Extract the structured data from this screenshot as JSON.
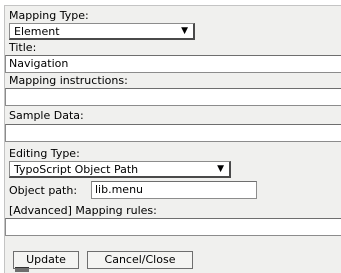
{
  "form": {
    "mapping_type_label": "Mapping Type:",
    "mapping_type_value": "Element",
    "title_label": "Title:",
    "title_value": "Navigation",
    "instructions_label": "Mapping instructions:",
    "instructions_value": "",
    "sample_label": "Sample Data:",
    "sample_value": "",
    "editing_type_label": "Editing Type:",
    "editing_type_value": "TypoScript Object Path",
    "object_path_label": "Object path:",
    "object_path_value": "lib.menu",
    "mapping_rules_label": "[Advanced] Mapping rules:",
    "mapping_rules_value": ""
  },
  "buttons": {
    "update": "Update",
    "cancel": "Cancel/Close"
  },
  "icons": {
    "dropdown": "chevron-down-icon"
  }
}
